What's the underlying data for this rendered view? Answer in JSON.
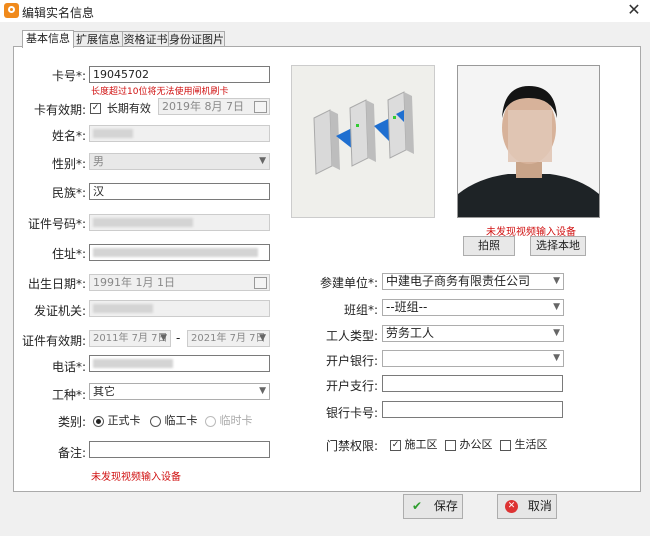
{
  "window": {
    "title": "编辑实名信息",
    "close": "✕"
  },
  "tabs": [
    "基本信息",
    "扩展信息",
    "资格证书",
    "身份证图片"
  ],
  "left": {
    "card_no": {
      "label": "卡号*:",
      "value": "19045702",
      "hint": "长度超过10位将无法使用闸机刷卡"
    },
    "card_validity": {
      "label": "卡有效期:",
      "checkbox": "长期有效",
      "date": "2019年 8月 7日"
    },
    "name": {
      "label": "姓名*:"
    },
    "gender": {
      "label": "性别*:",
      "value": "男"
    },
    "ethnic": {
      "label": "民族*:",
      "value": "汉"
    },
    "id_no": {
      "label": "证件号码*:"
    },
    "address": {
      "label": "住址*:"
    },
    "birth": {
      "label": "出生日期*:",
      "value": "1991年 1月 1日"
    },
    "issuer": {
      "label": "发证机关:"
    },
    "id_validity": {
      "label": "证件有效期:",
      "from": "2011年 7月 7日",
      "sep": "-",
      "to": "2021年 7月 7日"
    },
    "phone": {
      "label": "电话*:"
    },
    "job": {
      "label": "工种*:",
      "value": "其它"
    },
    "category": {
      "label": "类别:",
      "options": [
        "正式卡",
        "临工卡",
        "临时卡"
      ]
    },
    "remark": {
      "label": "备注:"
    },
    "video_msg": "未发现视频输入设备"
  },
  "right": {
    "no_video": "未发现视频输入设备",
    "btn_capture": "拍照",
    "btn_local": "选择本地",
    "unit": {
      "label": "参建单位*:",
      "value": "中建电子商务有限责任公司"
    },
    "team": {
      "label": "班组*:",
      "value": "--班组--"
    },
    "worker_type": {
      "label": "工人类型:",
      "value": "劳务工人"
    },
    "bank": {
      "label": "开户银行:",
      "value": ""
    },
    "branch": {
      "label": "开户支行:",
      "value": ""
    },
    "bank_card": {
      "label": "银行卡号:",
      "value": ""
    },
    "access": {
      "label": "门禁权限:",
      "options": [
        "施工区",
        "办公区",
        "生活区"
      ]
    }
  },
  "footer": {
    "save": "保存",
    "cancel": "取消"
  },
  "colors": {
    "accent": "#f08a1c",
    "error": "#d01010",
    "save_check": "#2e9d2e",
    "cancel_red": "#d33"
  }
}
